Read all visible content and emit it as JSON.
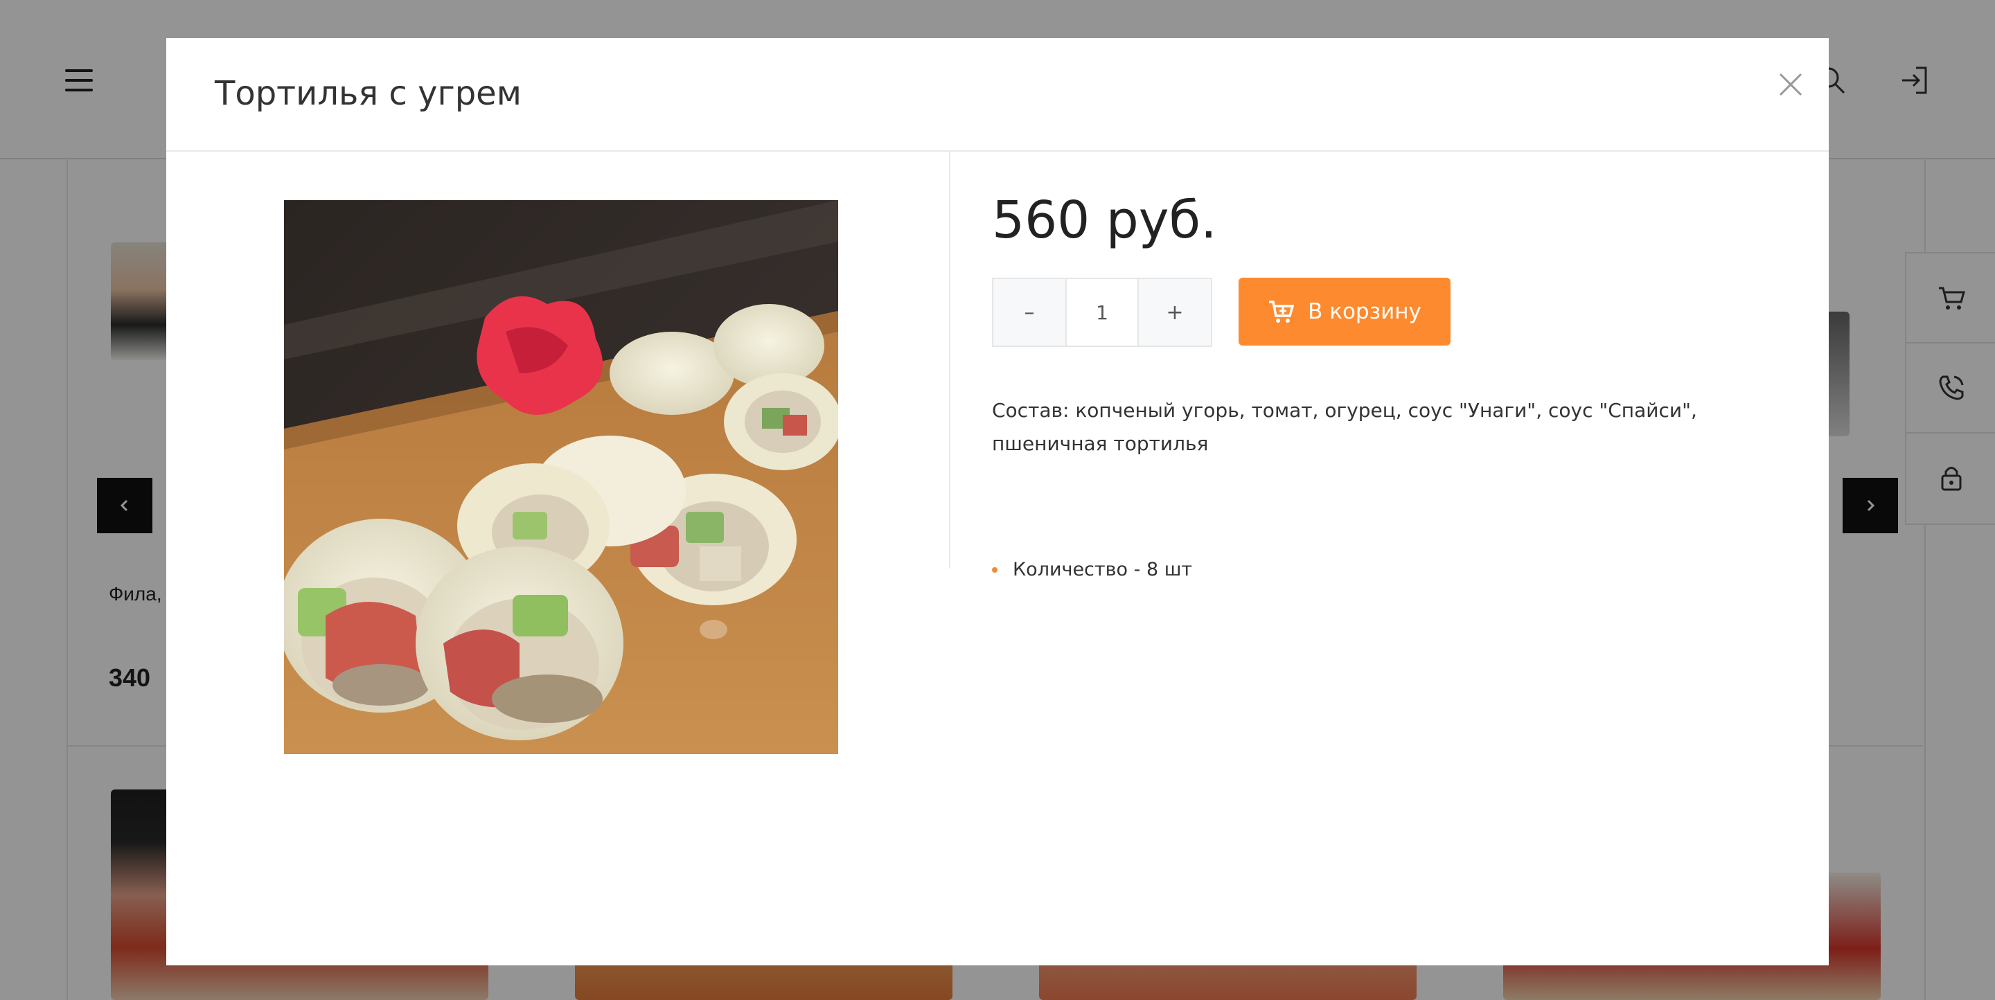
{
  "modal": {
    "title": "Тортилья с угрем",
    "price": "560 руб.",
    "quantity": "1",
    "decrement_label": "–",
    "increment_label": "+",
    "add_to_cart_label": "В корзину",
    "composition": "Состав: копченый угорь, томат, огурец, соус \"Унаги\", соус \"Спайси\", пшеничная тортилья",
    "properties": [
      "Количество - 8 шт"
    ]
  },
  "background": {
    "product_name_partial": "Фила,",
    "product_price_partial": "340"
  },
  "colors": {
    "accent": "#fd8a2e",
    "overlay": "rgba(0,0,0,0.42)"
  },
  "icons": [
    "menu-icon",
    "search-icon",
    "login-icon",
    "cart-icon",
    "callback-icon",
    "lock-icon",
    "chevron-left-icon",
    "chevron-right-icon",
    "close-icon",
    "cart-add-icon"
  ]
}
